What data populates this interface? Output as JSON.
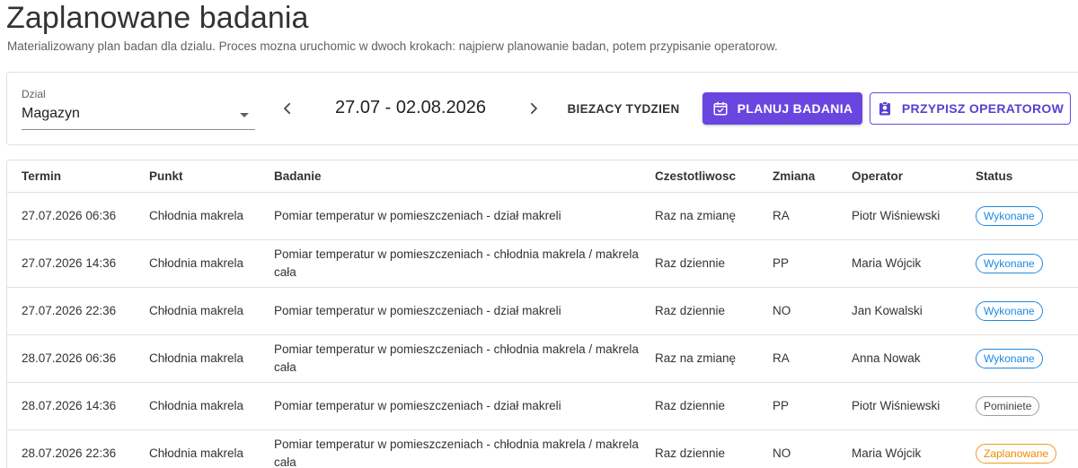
{
  "header": {
    "title": "Zaplanowane badania",
    "subtitle": "Materializowany plan badan dla dzialu. Proces mozna uruchomic w dwoch krokach: najpierw planowanie badan, potem przypisanie operatorow."
  },
  "toolbar": {
    "dept_label": "Dzial",
    "dept_value": "Magazyn",
    "week_range": "27.07 - 02.08.2026",
    "current_week_label": "BIEZACY TYDZIEN",
    "plan_label": "PLANUJ BADANIA",
    "assign_label": "PRZYPISZ OPERATOROW",
    "icons": {
      "prev": "chevron-left-icon",
      "next": "chevron-right-icon",
      "plan": "calendar-check-icon",
      "assign": "badge-person-icon",
      "dropdown": "caret-down-icon"
    }
  },
  "colors": {
    "primary": "#6a46e0",
    "status_done": "#1e88e5",
    "status_skipped": "#9e9e9e",
    "status_planned": "#f29b1f"
  },
  "table": {
    "columns": [
      "Termin",
      "Punkt",
      "Badanie",
      "Czestotliwosc",
      "Zmiana",
      "Operator",
      "Status"
    ],
    "rows": [
      {
        "termin": "27.07.2026 06:36",
        "punkt": "Chłodnia makrela",
        "badanie": "Pomiar temperatur w pomieszczeniach - dział makreli",
        "czest": "Raz na zmianę",
        "zmiana": "RA",
        "operator": "Piotr Wiśniewski",
        "status": "Wykonane",
        "status_kind": "done"
      },
      {
        "termin": "27.07.2026 14:36",
        "punkt": "Chłodnia makrela",
        "badanie": "Pomiar temperatur w pomieszczeniach - chłodnia makrela / makrela cała",
        "czest": "Raz dziennie",
        "zmiana": "PP",
        "operator": "Maria Wójcik",
        "status": "Wykonane",
        "status_kind": "done"
      },
      {
        "termin": "27.07.2026 22:36",
        "punkt": "Chłodnia makrela",
        "badanie": "Pomiar temperatur w pomieszczeniach - dział makreli",
        "czest": "Raz dziennie",
        "zmiana": "NO",
        "operator": "Jan Kowalski",
        "status": "Wykonane",
        "status_kind": "done"
      },
      {
        "termin": "28.07.2026 06:36",
        "punkt": "Chłodnia makrela",
        "badanie": "Pomiar temperatur w pomieszczeniach - chłodnia makrela / makrela cała",
        "czest": "Raz na zmianę",
        "zmiana": "RA",
        "operator": "Anna Nowak",
        "status": "Wykonane",
        "status_kind": "done"
      },
      {
        "termin": "28.07.2026 14:36",
        "punkt": "Chłodnia makrela",
        "badanie": "Pomiar temperatur w pomieszczeniach - dział makreli",
        "czest": "Raz dziennie",
        "zmiana": "PP",
        "operator": "Piotr Wiśniewski",
        "status": "Pominiete",
        "status_kind": "skipped"
      },
      {
        "termin": "28.07.2026 22:36",
        "punkt": "Chłodnia makrela",
        "badanie": "Pomiar temperatur w pomieszczeniach - chłodnia makrela / makrela cała",
        "czest": "Raz dziennie",
        "zmiana": "NO",
        "operator": "Maria Wójcik",
        "status": "Zaplanowane",
        "status_kind": "planned"
      }
    ]
  }
}
